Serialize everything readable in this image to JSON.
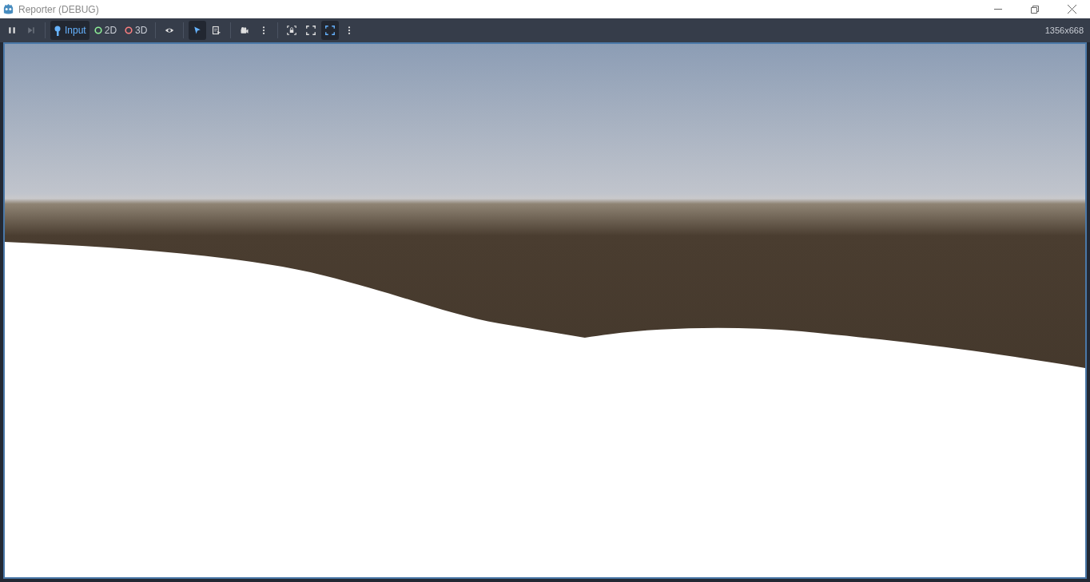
{
  "window": {
    "title": "Reporter (DEBUG)"
  },
  "toolbar": [
    {
      "kind": "pause",
      "selected": false,
      "disabled": false
    },
    {
      "kind": "step",
      "selected": false,
      "disabled": true
    },
    {
      "kind": "sep"
    },
    {
      "kind": "input",
      "label": "Input",
      "selected": true,
      "disabled": false
    },
    {
      "kind": "ring",
      "label": "2D",
      "color": "#8eef97",
      "selected": false,
      "disabled": false
    },
    {
      "kind": "ring",
      "label": "3D",
      "color": "#fc7f7f",
      "selected": false,
      "disabled": false
    },
    {
      "kind": "sep"
    },
    {
      "kind": "eye",
      "selected": false,
      "disabled": false
    },
    {
      "kind": "sep"
    },
    {
      "kind": "pointer",
      "selected": true,
      "disabled": false
    },
    {
      "kind": "listpointer",
      "selected": false,
      "disabled": false
    },
    {
      "kind": "sep"
    },
    {
      "kind": "camera",
      "selected": false,
      "disabled": false
    },
    {
      "kind": "kebab",
      "selected": false,
      "disabled": false
    },
    {
      "kind": "sep"
    },
    {
      "kind": "lockframe",
      "selected": false,
      "disabled": false
    },
    {
      "kind": "expand",
      "selected": false,
      "disabled": false
    },
    {
      "kind": "expand",
      "selected": true,
      "disabled": false
    },
    {
      "kind": "kebab",
      "selected": false,
      "disabled": false
    }
  ],
  "resolution": "1356x668"
}
